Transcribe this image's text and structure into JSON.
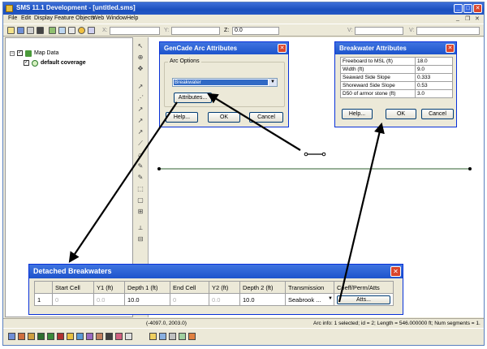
{
  "window": {
    "title": "SMS 11.1 Development - [untitled.sms]",
    "minimize": "_",
    "maximize": "□",
    "close": "✕"
  },
  "menu": {
    "items": [
      "File",
      "Edit",
      "Display",
      "Feature Objects",
      "Web",
      "Window",
      "Help"
    ],
    "mdi_minimize": "_",
    "mdi_restore": "❐",
    "mdi_close": "✕"
  },
  "toolbar": {
    "x_label": "X:",
    "y_label": "Y:",
    "z_label": "Z:",
    "z_value": "0.0",
    "v_label": "V:",
    "vy_label": "V:",
    "icons": [
      "new-icon",
      "save-icon",
      "print-icon",
      "delete-icon",
      "zoom-icon",
      "frame-icon",
      "refresh-icon",
      "sun-icon"
    ]
  },
  "explorer": {
    "root_label": "Map Data",
    "root_expander": "−",
    "child_label": "default coverage"
  },
  "gencade_dialog": {
    "title": "GenCade Arc Attributes",
    "group_label": "Arc Options",
    "select_value": "Breakwater",
    "attributes_btn": "Attributes...",
    "help_btn": "Help...",
    "ok_btn": "OK",
    "cancel_btn": "Cancel",
    "close": "✕"
  },
  "breakwater_dialog": {
    "title": "Breakwater Attributes",
    "rows": [
      {
        "label": "Freeboard to MSL (ft)",
        "value": "18.0"
      },
      {
        "label": "Width (ft)",
        "value": "9.0"
      },
      {
        "label": "Seaward Side Slope",
        "value": "0.333"
      },
      {
        "label": "Shoreward Side Slope",
        "value": "0.53"
      },
      {
        "label": "D50 of armor stone (ft)",
        "value": "3.0"
      }
    ],
    "help_btn": "Help...",
    "ok_btn": "OK",
    "cancel_btn": "Cancel",
    "close": "✕"
  },
  "detached_dialog": {
    "title": "Detached Breakwaters",
    "headers": [
      "",
      "Start Cell",
      "Y1 (ft)",
      "Depth 1 (ft)",
      "End Cell",
      "Y2 (ft)",
      "Depth 2 (ft)",
      "Transmission",
      "Coeff/Perm/Atts"
    ],
    "row": {
      "index": "1",
      "start_cell": "0",
      "y1": "0.0",
      "depth1": "10.0",
      "end_cell": "0",
      "y2": "0.0",
      "depth2": "10.0",
      "transmission": "Seabrook ...",
      "atts_btn": "Atts..."
    },
    "close": "✕"
  },
  "status": {
    "coords": "(-4097.0, 2003.0)",
    "info": "Arc info: 1 selected; id = 2; Length = 546.000000 ft; Num segments = 1."
  },
  "colors": {
    "title_blue": "#1a4fbe",
    "arc_line": "#2f5f2f",
    "arrow": "#000000"
  }
}
